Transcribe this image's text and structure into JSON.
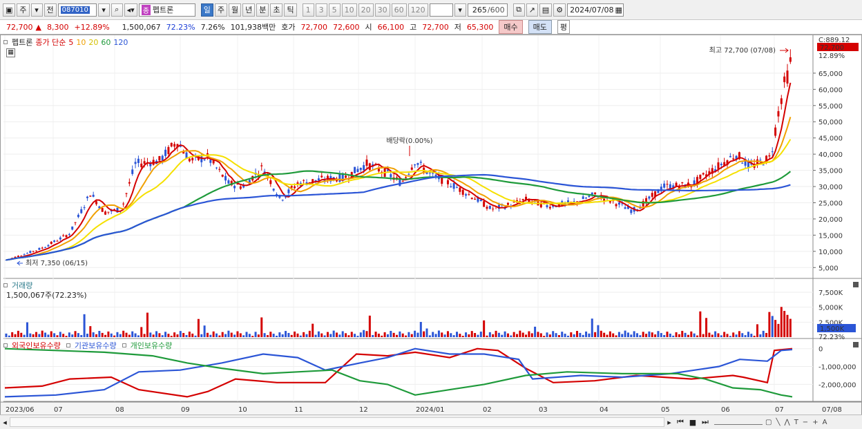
{
  "toolbar": {
    "market_btn": "주",
    "prev_btn": "전",
    "code": "087010",
    "stock_name": "펩트론",
    "name_badge": "종",
    "periods": [
      "일",
      "주",
      "월",
      "년",
      "분",
      "초",
      "틱"
    ],
    "period_selected": "일",
    "intervals": [
      "1",
      "3",
      "5",
      "10",
      "20",
      "30",
      "60",
      "120"
    ],
    "count": "265",
    "count_max": "/600",
    "date": "2024/07/08"
  },
  "info": {
    "price": "72,700",
    "change": "8,300",
    "change_pct": "+12.89%",
    "volume": "1,500,067",
    "vol_ratio": "72.23%",
    "turnover": "7.26%",
    "amount": "101,938백만",
    "bid_label": "호가",
    "ask": "72,700",
    "bid": "72,600",
    "open_label": "시",
    "open": "66,100",
    "high_label": "고",
    "high": "72,700",
    "low_label": "저",
    "low": "65,300",
    "buy": "매수",
    "sell": "매도",
    "avg": "평"
  },
  "price_panel": {
    "name": "펩트론",
    "ma_label": "종가 단순",
    "ma_periods": [
      "5",
      "10",
      "20",
      "60",
      "120"
    ],
    "ma_colors": [
      "#d40000",
      "#f0a000",
      "#f5e000",
      "#1e9a3a",
      "#2b55d6"
    ],
    "high_note": "최고 72,700 (07/08)",
    "low_note": "최저 7,350 (06/15)",
    "dividend_note": "배당락(0.00%)",
    "top_label": "C:889.12",
    "last_price": "72,700",
    "last_pct": "12.89%",
    "y_ticks": [
      "65,000",
      "60,000",
      "55,000",
      "50,000",
      "45,000",
      "40,000",
      "35,000",
      "30,000",
      "25,000",
      "20,000",
      "15,000",
      "10,000",
      "5,000"
    ]
  },
  "volume_panel": {
    "title": "거래량",
    "value": "1,500,067주(72.23%)",
    "y_ticks": [
      "7,500K",
      "5,000K",
      "2,500K"
    ],
    "last": "1,500K",
    "last_pct": "72.23%"
  },
  "holding_panel": {
    "series": [
      "외국인보유수량",
      "기관보유수량",
      "개인보유수량"
    ],
    "colors": [
      "#d40000",
      "#2b55d6",
      "#1e9a3a"
    ],
    "y_ticks": [
      "0",
      "-1,000,000",
      "-2,000,000"
    ]
  },
  "x_labels": [
    "2023/06",
    "07",
    "08",
    "09",
    "10",
    "11",
    "12",
    "2024/01",
    "02",
    "03",
    "04",
    "05",
    "06",
    "07",
    "07/08"
  ],
  "chart_data": {
    "type": "line",
    "title": "펩트론",
    "months": [
      "2023/06",
      "07",
      "08",
      "09",
      "10",
      "11",
      "12",
      "2024/01",
      "02",
      "03",
      "04",
      "05",
      "06",
      "07"
    ],
    "close_approx": [
      7350,
      13000,
      25000,
      40000,
      32000,
      31000,
      34000,
      38000,
      26000,
      24000,
      26000,
      29000,
      40000,
      72700
    ],
    "ylim": [
      5000,
      72700
    ],
    "high": 72700,
    "low": 7350
  }
}
